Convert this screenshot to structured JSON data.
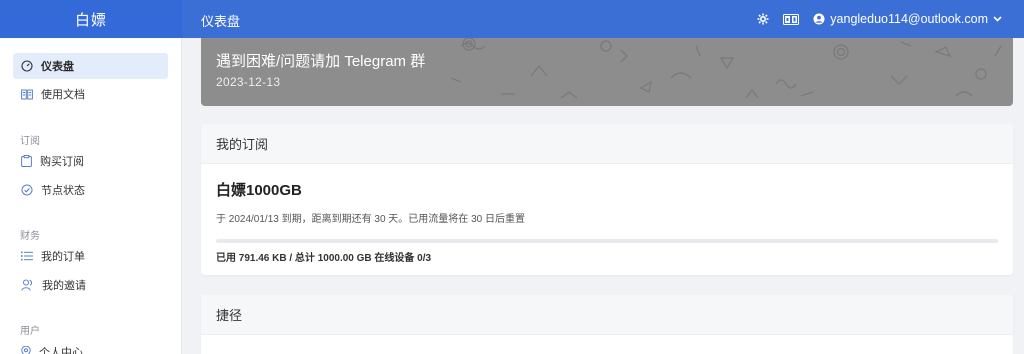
{
  "brand": "白嫖",
  "header": {
    "page_title": "仪表盘",
    "user_email": "yangleduo114@outlook.com",
    "icons": [
      "gear-icon",
      "translate-icon",
      "user-icon",
      "chevron-down-icon"
    ]
  },
  "sidebar": {
    "items": [
      {
        "label": "仪表盘",
        "icon": "gauge-icon"
      },
      {
        "label": "使用文档",
        "icon": "book-icon"
      },
      {
        "label": "购买订阅",
        "icon": "clipboard-icon"
      },
      {
        "label": "节点状态",
        "icon": "check-circle-icon"
      },
      {
        "label": "我的订单",
        "icon": "list-icon"
      },
      {
        "label": "我的邀请",
        "icon": "people-icon"
      },
      {
        "label": "个人中心",
        "icon": "pin-icon"
      }
    ],
    "sections": [
      "订阅",
      "财务",
      "用户"
    ]
  },
  "banner": {
    "title": "遇到困难/问题请加 Telegram 群",
    "date": "2023-12-13"
  },
  "subscription": {
    "header": "我的订阅",
    "plan_name": "白嫖1000GB",
    "description": "于 2024/01/13 到期，距离到期还有 30 天。已用流量将在 30 日后重置",
    "usage_text": "已用 791.46 KB / 总计 1000.00 GB 在线设备 0/3",
    "usage_fraction": 8e-07
  },
  "shortcuts": {
    "header": "捷径"
  },
  "colors": {
    "primary": "#3b6fd6",
    "sidebar_active": "#e3ecfa",
    "banner": "#8d8d8d"
  }
}
